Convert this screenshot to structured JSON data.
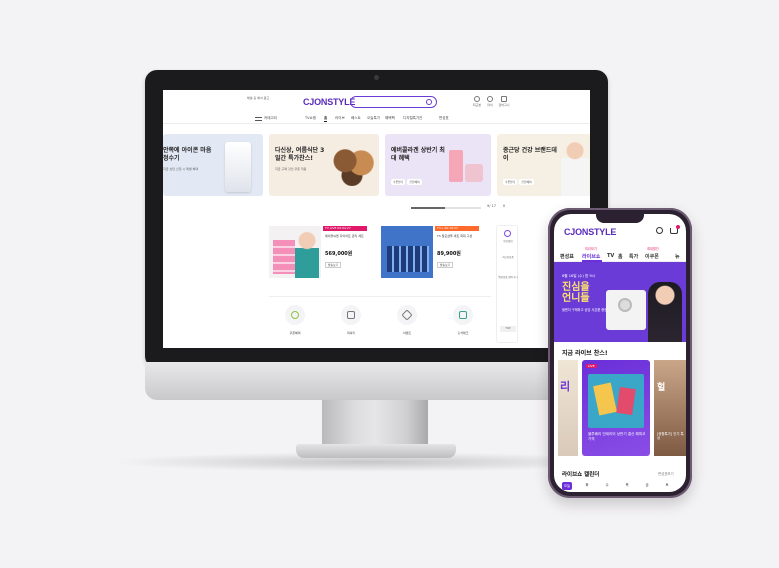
{
  "colors": {
    "brand": "#5a2bbb",
    "accent": "#6a2fd8",
    "pink": "#e0196a",
    "background": "#f3f2f4"
  },
  "desktop": {
    "logo": "CJONSTYLE",
    "mini_banner": "채널 홈 에서 광고",
    "utilities": [
      "최근본",
      "마이",
      "장바구니"
    ],
    "nav": {
      "menu_label": "카테고리",
      "items": [
        "TV쇼핑",
        "홈",
        "라이브",
        "베스트",
        "오늘특가",
        "해택팩",
        "디지털특가관",
        "편성표"
      ]
    },
    "banners": [
      {
        "title": "안쪽에 아이콘 마음 정수기",
        "sub": "지금 상담 신청 시 특별 혜택"
      },
      {
        "title": "다신상, 여름식단 3일간 특가찬스!",
        "sub": "지금 구매 할인 쿠폰 적용",
        "chips": [
          "쿠폰받기",
          "할인혜택"
        ]
      },
      {
        "title": "에버콜라겐 상반기 최대 혜택",
        "sub": "",
        "chips": [
          "쿠폰받기",
          "할인혜택"
        ]
      },
      {
        "title": "종근당 건강 브랜드데이",
        "sub": "",
        "chips": [
          "쿠폰받기",
          "할인혜택"
        ]
      }
    ],
    "pager": {
      "current": "9/ 17",
      "control": "II"
    },
    "live_items": [
      {
        "tag": "TV LIVE 00:04:27",
        "desc": "에이블씨엔 다이어트 관리 세트",
        "price": "569,000원",
        "button": "방송보기"
      },
      {
        "tag": "TV+ 00:18:27",
        "desc": "TS 탈모샴푸 세트 최대 구성",
        "price": "89,900원",
        "button": "방송보기"
      }
    ],
    "side": {
      "alarm_label": "방송알림",
      "labels": [
        "최근본상품",
        "찜한상품 장바구니"
      ],
      "top": "TOP"
    },
    "categories": [
      "쿠폰혜택",
      "럭셔리",
      "이벤트",
      "출석체크"
    ]
  },
  "phone": {
    "logo": "CJONSTYLE",
    "tabs": [
      {
        "label": "편성표",
        "sub": ""
      },
      {
        "label": "라이브쇼",
        "sub": "미리보기"
      },
      {
        "label": "TV",
        "sub": ""
      },
      {
        "label": "홈",
        "sub": ""
      },
      {
        "label": "특가",
        "sub": ""
      },
      {
        "label": "이쿠폰",
        "sub": "최대할인"
      },
      {
        "label": "뉴",
        "sub": ""
      }
    ],
    "banner": {
      "date": "6월 16일 (수) 밤 9시",
      "headline": "진심을 언니들",
      "sub": "블렌더 구매하고 상담 사은품 증정"
    },
    "live_section_title": "지금 라이브 찬스!",
    "live_cards": [
      {
        "badge": "LIVE",
        "caption": "블루베리 인테리어 상반기 결산 해피코 가격"
      },
      {
        "caption": "[종합특가] 인기 특상"
      }
    ],
    "calendar": {
      "title": "라이브쇼 캘린더",
      "more": "편성표보기",
      "days": [
        "오늘",
        "화",
        "수",
        "목",
        "금",
        "토"
      ]
    }
  }
}
